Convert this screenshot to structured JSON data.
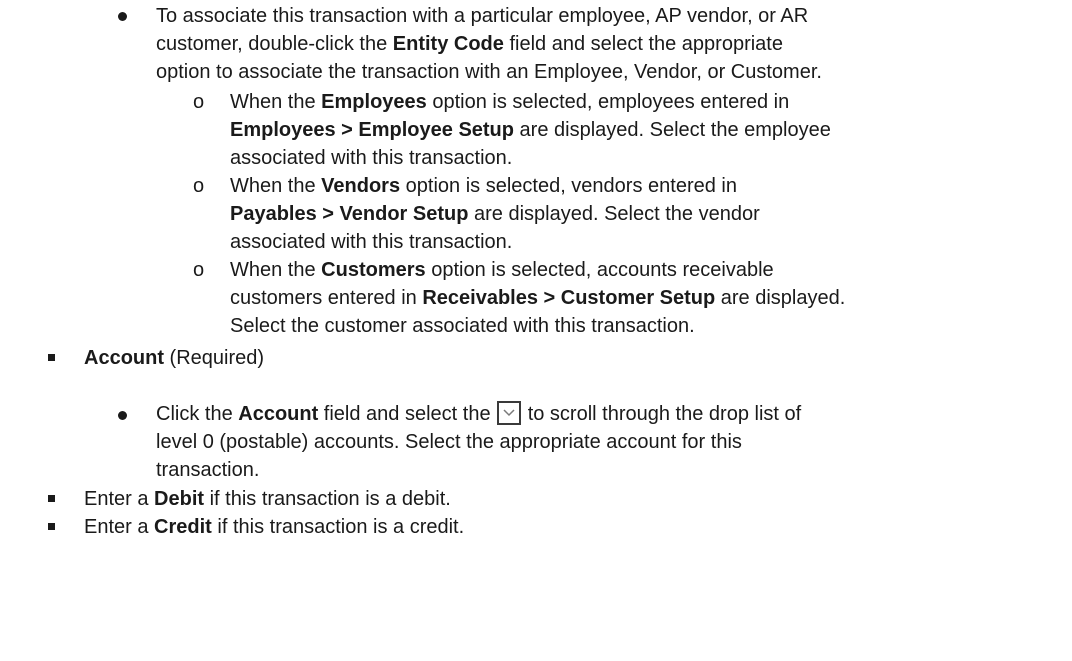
{
  "entity": {
    "p1": "To associate this transaction with a particular employee, AP vendor, or AR",
    "p2a": "customer, double-click the ",
    "p2b": "Entity Code",
    "p2c": " field and select the appropriate",
    "p3": "option to associate the transaction with an Employee, Vendor, or Customer."
  },
  "employees": {
    "l1a": "When the ",
    "l1b": "Employees",
    "l1c": " option is selected, employees entered in",
    "l2a": "Employees > Employee Setup",
    "l2b": " are displayed. Select the employee",
    "l3": "associated with this transaction."
  },
  "vendors": {
    "l1a": "When the ",
    "l1b": "Vendors",
    "l1c": " option is selected, vendors entered in",
    "l2a": "Payables > Vendor Setup",
    "l2b": " are displayed. Select the vendor",
    "l3": "associated with this transaction."
  },
  "customers": {
    "l1a": "When the ",
    "l1b": "Customers",
    "l1c": " option is selected, accounts receivable",
    "l2a": "customers entered in ",
    "l2b": "Receivables > Customer Setup",
    "l2c": " are displayed.",
    "l3": "Select the customer associated with this transaction."
  },
  "account": {
    "title": "Account",
    "required": " (Required)",
    "l1a": "Click the ",
    "l1b": "Account",
    "l1c": " field and select the ",
    "l1d": " to scroll through the drop list of",
    "l2": "level 0 (postable) accounts. Select the appropriate account for this",
    "l3": "transaction.",
    "dropdown_icon": "chevron-down-icon"
  },
  "debit": {
    "a": "Enter a ",
    "b": "Debit",
    "c": " if this transaction is a debit."
  },
  "credit": {
    "a": "Enter a ",
    "b": "Credit",
    "c": " if this transaction is a credit."
  }
}
